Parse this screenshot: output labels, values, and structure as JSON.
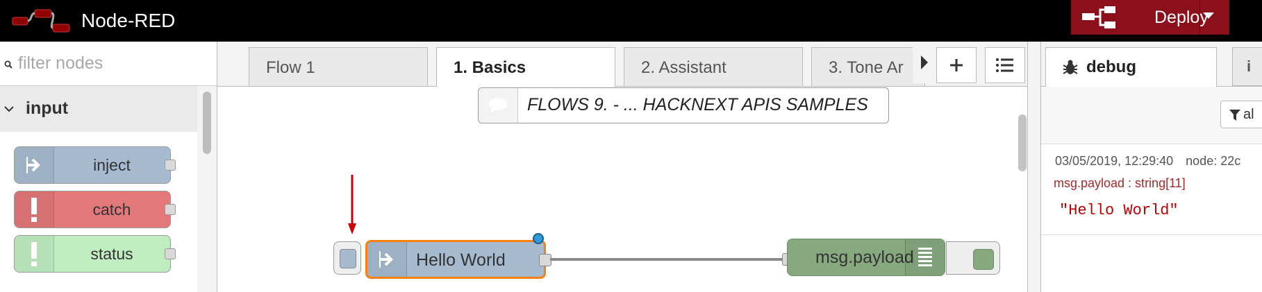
{
  "header": {
    "title": "Node-RED",
    "deploy_label": "Deploy"
  },
  "palette": {
    "search_placeholder": "filter nodes",
    "category": "input",
    "nodes": [
      {
        "label": "inject",
        "color": "#a6bbcf",
        "icon": "arrow-in-icon"
      },
      {
        "label": "catch",
        "color": "#e2787a",
        "icon": "exclamation-icon"
      },
      {
        "label": "status",
        "color": "#c0edc0",
        "icon": "exclamation-icon"
      }
    ]
  },
  "workspace": {
    "tabs": [
      "Flow 1",
      "1. Basics",
      "2. Assistant",
      "3. Tone Ar"
    ],
    "active_tab": "1. Basics",
    "comment": "FLOWS 9. - ... HACKNEXT APIS SAMPLES",
    "inject_node_label": "Hello World",
    "debug_node_label": "msg.payload"
  },
  "sidebar": {
    "tab_label": "debug",
    "second_tab": "i",
    "filter_label": "al",
    "message": {
      "timestamp": "03/05/2019, 12:29:40",
      "node": "node: 22c",
      "name": "msg.payload : string[11]",
      "value": "\"Hello World\""
    }
  },
  "colors": {
    "header_bg": "#000000",
    "deploy_bg": "#8c101c",
    "selection": "#ff7f0e",
    "inject": "#a6bbcf",
    "catch": "#e2787a",
    "status": "#c0edc0",
    "debug": "#87a980"
  }
}
